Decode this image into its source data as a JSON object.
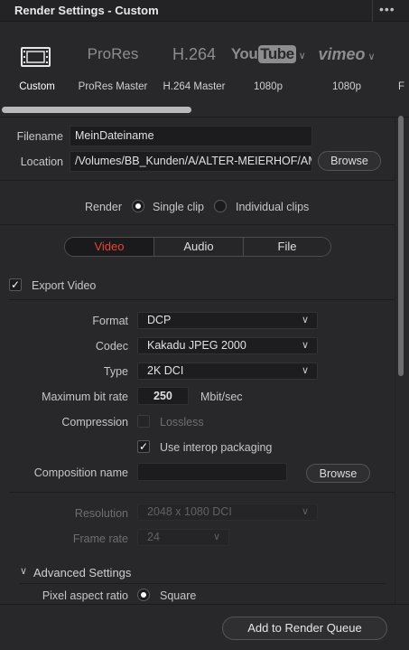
{
  "window": {
    "title": "Render Settings - Custom",
    "menu_icon": "more-dots-icon"
  },
  "presets": [
    {
      "name": "Custom",
      "logo_text": "",
      "icon": "film-strip-icon",
      "active": true
    },
    {
      "name": "ProRes Master",
      "logo_text": "ProRes",
      "active": false
    },
    {
      "name": "H.264 Master",
      "logo_text": "H.264",
      "active": false
    },
    {
      "name": "1080p",
      "logo_text": "YouTube",
      "logo_you": "You",
      "logo_tube": "Tube",
      "active": false
    },
    {
      "name": "1080p",
      "logo_text": "vimeo",
      "active": false
    },
    {
      "name": "F",
      "logo_text": "",
      "active": false
    }
  ],
  "file": {
    "filename_label": "Filename",
    "filename_value": "MeinDateiname",
    "location_label": "Location",
    "location_value": "/Volumes/BB_Kunden/A/ALTER-MEIERHOF/AME",
    "browse_label": "Browse"
  },
  "render": {
    "label": "Render",
    "single_clip": "Single clip",
    "individual_clips": "Individual clips",
    "selected": "single_clip"
  },
  "tabs": [
    {
      "label": "Video",
      "active": true
    },
    {
      "label": "Audio",
      "active": false
    },
    {
      "label": "File",
      "active": false
    }
  ],
  "video": {
    "export_video_label": "Export Video",
    "export_video_checked": true,
    "format_label": "Format",
    "format_value": "DCP",
    "codec_label": "Codec",
    "codec_value": "Kakadu JPEG 2000",
    "type_label": "Type",
    "type_value": "2K DCI",
    "bitrate_label": "Maximum bit rate",
    "bitrate_value": "250",
    "bitrate_unit": "Mbit/sec",
    "compression_label": "Compression",
    "lossless_label": "Lossless",
    "lossless_checked": false,
    "interop_label": "Use interop packaging",
    "interop_checked": true,
    "composition_label": "Composition name",
    "composition_value": "",
    "composition_browse": "Browse",
    "resolution_label": "Resolution",
    "resolution_value": "2048 x 1080 DCI",
    "framerate_label": "Frame rate",
    "framerate_value": "24",
    "advanced_label": "Advanced Settings",
    "pixel_aspect_label": "Pixel aspect ratio",
    "pixel_aspect_value": "Square"
  },
  "footer": {
    "add_to_queue_label": "Add to Render Queue"
  },
  "colors": {
    "active_tab_text": "#e8443a",
    "background": "#28282b",
    "field_bg": "#1c1c1e"
  }
}
